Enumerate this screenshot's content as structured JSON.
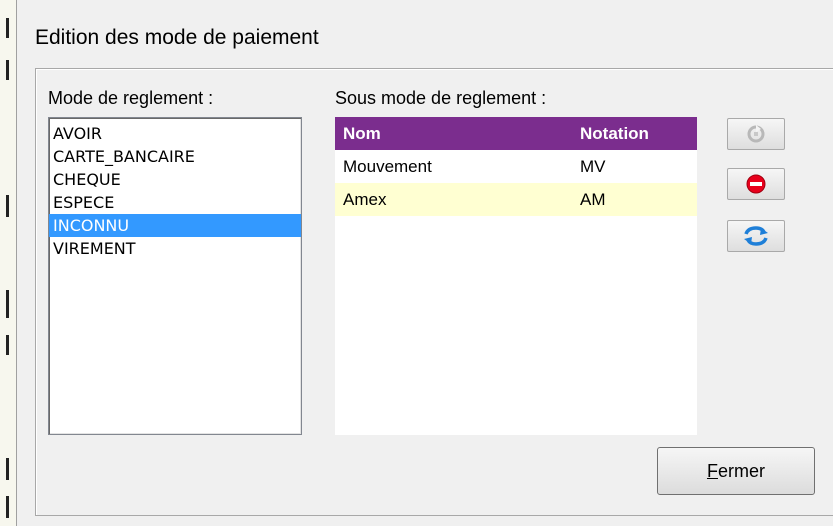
{
  "window": {
    "title": "Edition des mode de paiement"
  },
  "mode_list": {
    "label": "Mode de reglement :",
    "items": [
      {
        "label": "AVOIR",
        "selected": false
      },
      {
        "label": "CARTE_BANCAIRE",
        "selected": false
      },
      {
        "label": "CHEQUE",
        "selected": false
      },
      {
        "label": "ESPECE",
        "selected": false
      },
      {
        "label": "INCONNU",
        "selected": true
      },
      {
        "label": "VIREMENT",
        "selected": false
      }
    ]
  },
  "sub_mode_grid": {
    "label": "Sous mode de reglement :",
    "columns": [
      "Nom",
      "Notation"
    ],
    "rows": [
      [
        "Mouvement",
        "MV"
      ],
      [
        "Amex",
        "AM"
      ]
    ],
    "header_color": "#7b2d8e",
    "alt_row_color": "#ffffd2"
  },
  "toolbar": {
    "add_icon": "add-icon",
    "delete_icon": "delete-icon",
    "refresh_icon": "refresh-icon"
  },
  "close_button": {
    "mnemonic": "F",
    "rest": "ermer"
  },
  "colors": {
    "selection": "#3399ff",
    "delete": "#e8001c",
    "refresh": "#1e7fd8"
  }
}
